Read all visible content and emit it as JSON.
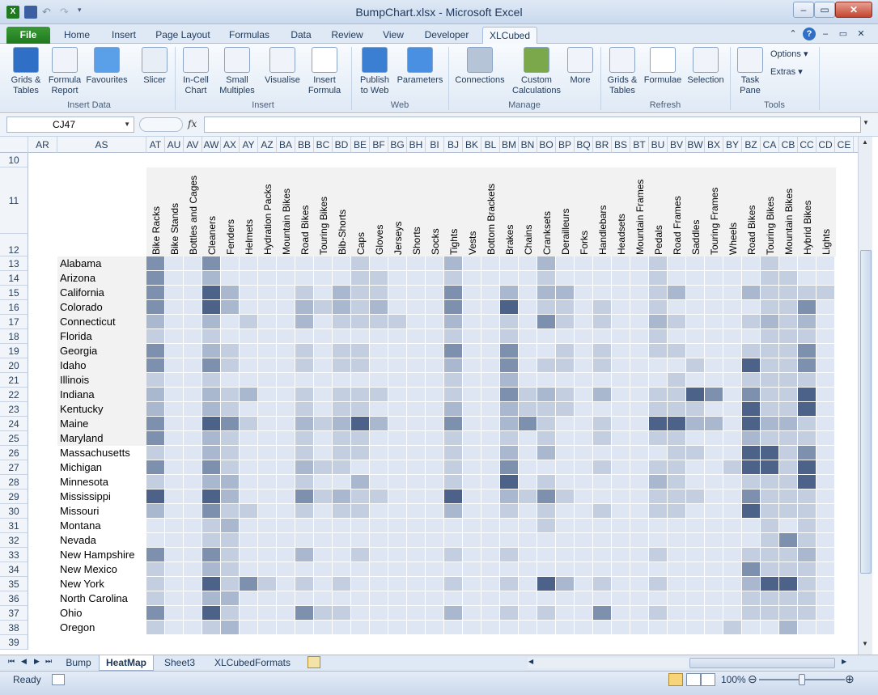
{
  "window": {
    "title": "BumpChart.xlsx  -  Microsoft Excel",
    "minimize": "–",
    "restore": "▭",
    "close": "✕"
  },
  "ribbon_tabs": [
    "File",
    "Home",
    "Insert",
    "Page Layout",
    "Formulas",
    "Data",
    "Review",
    "View",
    "Developer",
    "XLCubed"
  ],
  "active_tab": "XLCubed",
  "ribbon": {
    "buttons": [
      {
        "label": "Grids &\nTables",
        "icon": "cube-icon"
      },
      {
        "label": "Formula\nReport",
        "icon": "formula-report-icon"
      },
      {
        "label": "Favourites",
        "icon": "star-icon"
      },
      {
        "label": "Slicer",
        "icon": "slicer-icon"
      },
      {
        "label": "In-Cell\nChart",
        "icon": "incell-chart-icon"
      },
      {
        "label": "Small\nMultiples",
        "icon": "small-multiples-icon"
      },
      {
        "label": "Visualise",
        "icon": "visualise-icon"
      },
      {
        "label": "Insert\nFormula",
        "icon": "fx-icon"
      },
      {
        "label": "Publish\nto Web",
        "icon": "globe-icon"
      },
      {
        "label": "Parameters",
        "icon": "parameters-icon"
      },
      {
        "label": "Connections",
        "icon": "database-icon"
      },
      {
        "label": "Custom\nCalculations",
        "icon": "calculator-icon"
      },
      {
        "label": "More",
        "icon": "more-icon"
      },
      {
        "label": "Grids &\nTables",
        "icon": "refresh-grid-icon"
      },
      {
        "label": "Formulae",
        "icon": "refresh-fx-icon"
      },
      {
        "label": "Selection",
        "icon": "selection-icon"
      },
      {
        "label": "Task\nPane",
        "icon": "task-pane-icon"
      }
    ],
    "options_label": "Options",
    "extras_label": "Extras",
    "groups": [
      "Insert Data",
      "Insert",
      "Web",
      "Manage",
      "Refresh",
      "Tools"
    ]
  },
  "formula_bar": {
    "name_box": "CJ47",
    "fx": "fx",
    "formula": ""
  },
  "columns": [
    "AR",
    "AS",
    "AT",
    "AU",
    "AV",
    "AW",
    "AX",
    "AY",
    "AZ",
    "BA",
    "BB",
    "BC",
    "BD",
    "BE",
    "BF",
    "BG",
    "BH",
    "BI",
    "BJ",
    "BK",
    "BL",
    "BM",
    "BN",
    "BO",
    "BP",
    "BQ",
    "BR",
    "BS",
    "BT",
    "BU",
    "BV",
    "BW",
    "BX",
    "BY",
    "BZ",
    "CA",
    "CB",
    "CC",
    "CD",
    "CE"
  ],
  "row_numbers": [
    "10",
    "11",
    "12",
    "13",
    "14",
    "15",
    "16",
    "17",
    "18",
    "19",
    "20",
    "21",
    "22",
    "23",
    "24",
    "25",
    "26",
    "27",
    "28",
    "29",
    "30",
    "31",
    "32",
    "33",
    "34",
    "35",
    "36",
    "37",
    "38",
    "39"
  ],
  "products": [
    "Bike Racks",
    "Bike Stands",
    "Bottles and Cages",
    "Cleaners",
    "Fenders",
    "Helmets",
    "Hydration Packs",
    "Mountain Bikes",
    "Road Bikes",
    "Touring Bikes",
    "Bib-Shorts",
    "Caps",
    "Gloves",
    "Jerseys",
    "Shorts",
    "Socks",
    "Tights",
    "Vests",
    "Bottom Brackets",
    "Brakes",
    "Chains",
    "Cranksets",
    "Derailleurs",
    "Forks",
    "Handlebars",
    "Headsets",
    "Mountain Frames",
    "Pedals",
    "Road Frames",
    "Saddles",
    "Touring Frames",
    "Wheels",
    "Road Bikes",
    "Touring Bikes",
    "Mountain Bikes",
    "Hybrid Bikes",
    "Lights"
  ],
  "states": [
    "Alabama",
    "Arizona",
    "California",
    "Colorado",
    "Connecticut",
    "Florida",
    "Georgia",
    "Idaho",
    "Illinois",
    "Indiana",
    "Kentucky",
    "Maine",
    "Maryland",
    "Massachusetts",
    "Michigan",
    "Minnesota",
    "Mississippi",
    "Missouri",
    "Montana",
    "Nevada",
    "New Hampshire",
    "New Mexico",
    "New York",
    "North Carolina",
    "Ohio",
    "Oregon"
  ],
  "heatmap_levels": [
    [
      3,
      0,
      0,
      3,
      0,
      0,
      0,
      0,
      0,
      0,
      0,
      1,
      0,
      0,
      0,
      0,
      2,
      0,
      0,
      0,
      0,
      2,
      0,
      0,
      0,
      0,
      0,
      1,
      0,
      0,
      0,
      0,
      0,
      1,
      0,
      0,
      0
    ],
    [
      3,
      0,
      0,
      2,
      0,
      0,
      0,
      0,
      0,
      0,
      0,
      1,
      1,
      0,
      0,
      0,
      1,
      0,
      0,
      0,
      0,
      1,
      0,
      0,
      0,
      0,
      0,
      1,
      0,
      0,
      0,
      0,
      0,
      1,
      1,
      0,
      0
    ],
    [
      3,
      0,
      0,
      4,
      2,
      0,
      0,
      0,
      1,
      0,
      2,
      1,
      1,
      0,
      0,
      0,
      3,
      0,
      0,
      2,
      0,
      2,
      2,
      0,
      0,
      0,
      0,
      1,
      2,
      0,
      0,
      0,
      2,
      1,
      1,
      1,
      1
    ],
    [
      3,
      0,
      0,
      4,
      2,
      0,
      0,
      0,
      2,
      1,
      2,
      1,
      2,
      0,
      0,
      0,
      3,
      0,
      0,
      4,
      0,
      1,
      1,
      0,
      1,
      0,
      0,
      1,
      0,
      0,
      0,
      0,
      0,
      1,
      1,
      3,
      0
    ],
    [
      2,
      0,
      0,
      2,
      0,
      1,
      0,
      0,
      2,
      0,
      1,
      1,
      1,
      1,
      0,
      0,
      2,
      0,
      0,
      1,
      0,
      3,
      1,
      0,
      1,
      0,
      0,
      2,
      1,
      0,
      0,
      0,
      1,
      2,
      1,
      2,
      0
    ],
    [
      1,
      0,
      0,
      1,
      0,
      0,
      0,
      0,
      0,
      0,
      0,
      0,
      0,
      0,
      0,
      0,
      1,
      0,
      0,
      1,
      0,
      0,
      0,
      0,
      0,
      0,
      0,
      1,
      0,
      0,
      0,
      0,
      0,
      1,
      1,
      1,
      0
    ],
    [
      3,
      0,
      0,
      2,
      1,
      0,
      0,
      0,
      1,
      0,
      1,
      1,
      0,
      0,
      0,
      0,
      3,
      0,
      0,
      3,
      0,
      0,
      1,
      0,
      1,
      0,
      0,
      1,
      1,
      0,
      0,
      0,
      1,
      1,
      1,
      3,
      0
    ],
    [
      3,
      0,
      0,
      3,
      1,
      0,
      0,
      0,
      1,
      0,
      1,
      1,
      0,
      0,
      0,
      0,
      2,
      0,
      0,
      3,
      0,
      1,
      1,
      0,
      1,
      0,
      0,
      0,
      0,
      1,
      0,
      0,
      4,
      1,
      1,
      3,
      0
    ],
    [
      1,
      0,
      0,
      1,
      0,
      0,
      0,
      0,
      0,
      0,
      0,
      0,
      0,
      0,
      0,
      0,
      1,
      0,
      0,
      2,
      0,
      0,
      0,
      0,
      0,
      0,
      0,
      0,
      1,
      0,
      0,
      0,
      1,
      1,
      1,
      1,
      0
    ],
    [
      2,
      0,
      0,
      2,
      1,
      2,
      0,
      0,
      1,
      0,
      1,
      1,
      1,
      0,
      0,
      0,
      1,
      0,
      0,
      3,
      1,
      2,
      1,
      0,
      2,
      0,
      0,
      1,
      1,
      4,
      3,
      0,
      3,
      1,
      1,
      4,
      0
    ],
    [
      2,
      0,
      0,
      2,
      1,
      0,
      0,
      0,
      1,
      0,
      1,
      1,
      0,
      0,
      0,
      0,
      2,
      0,
      0,
      2,
      1,
      1,
      1,
      0,
      0,
      0,
      0,
      1,
      1,
      1,
      0,
      0,
      4,
      1,
      1,
      4,
      0
    ],
    [
      3,
      0,
      0,
      4,
      3,
      1,
      0,
      0,
      2,
      1,
      2,
      4,
      2,
      0,
      0,
      0,
      3,
      0,
      0,
      2,
      3,
      1,
      0,
      0,
      1,
      0,
      0,
      4,
      4,
      2,
      2,
      0,
      4,
      2,
      2,
      1,
      0
    ],
    [
      3,
      0,
      0,
      2,
      1,
      0,
      0,
      0,
      1,
      0,
      1,
      1,
      0,
      0,
      0,
      0,
      1,
      0,
      0,
      1,
      0,
      1,
      0,
      0,
      1,
      0,
      0,
      1,
      1,
      0,
      0,
      0,
      2,
      1,
      1,
      1,
      0
    ],
    [
      1,
      0,
      0,
      2,
      1,
      0,
      0,
      0,
      1,
      0,
      1,
      1,
      0,
      0,
      0,
      0,
      1,
      0,
      0,
      2,
      0,
      2,
      0,
      0,
      0,
      0,
      0,
      0,
      1,
      1,
      0,
      0,
      4,
      4,
      1,
      3,
      0
    ],
    [
      3,
      0,
      0,
      3,
      1,
      0,
      0,
      0,
      2,
      1,
      1,
      0,
      0,
      0,
      0,
      0,
      1,
      0,
      0,
      3,
      0,
      0,
      0,
      0,
      1,
      0,
      0,
      1,
      1,
      0,
      0,
      1,
      4,
      4,
      1,
      4,
      0
    ],
    [
      1,
      0,
      0,
      2,
      2,
      0,
      0,
      0,
      1,
      0,
      0,
      2,
      0,
      0,
      0,
      0,
      1,
      0,
      0,
      4,
      0,
      1,
      0,
      0,
      0,
      0,
      0,
      2,
      1,
      0,
      0,
      0,
      1,
      1,
      1,
      4,
      0
    ],
    [
      4,
      0,
      0,
      4,
      2,
      0,
      0,
      0,
      3,
      1,
      2,
      1,
      1,
      0,
      0,
      0,
      4,
      0,
      0,
      2,
      1,
      3,
      1,
      0,
      0,
      0,
      0,
      1,
      1,
      1,
      0,
      0,
      3,
      1,
      1,
      1,
      0
    ],
    [
      2,
      0,
      0,
      3,
      1,
      1,
      0,
      0,
      1,
      0,
      1,
      1,
      0,
      0,
      0,
      0,
      2,
      0,
      0,
      1,
      0,
      1,
      0,
      0,
      1,
      0,
      0,
      1,
      1,
      0,
      0,
      0,
      4,
      1,
      1,
      1,
      0
    ],
    [
      0,
      0,
      0,
      1,
      2,
      0,
      0,
      0,
      0,
      0,
      0,
      0,
      0,
      0,
      0,
      0,
      0,
      0,
      0,
      0,
      0,
      1,
      0,
      0,
      0,
      0,
      0,
      0,
      0,
      0,
      0,
      0,
      0,
      1,
      0,
      1,
      0
    ],
    [
      0,
      0,
      0,
      1,
      1,
      0,
      0,
      0,
      0,
      0,
      0,
      0,
      0,
      0,
      0,
      0,
      0,
      0,
      0,
      0,
      0,
      0,
      0,
      0,
      0,
      0,
      0,
      0,
      0,
      0,
      0,
      0,
      0,
      1,
      3,
      1,
      0
    ],
    [
      3,
      0,
      0,
      3,
      1,
      0,
      0,
      0,
      2,
      0,
      0,
      1,
      0,
      0,
      0,
      0,
      1,
      0,
      0,
      1,
      0,
      0,
      0,
      0,
      0,
      0,
      0,
      1,
      0,
      0,
      0,
      0,
      1,
      1,
      1,
      2,
      0
    ],
    [
      1,
      0,
      0,
      2,
      1,
      0,
      0,
      0,
      0,
      0,
      0,
      0,
      0,
      0,
      0,
      0,
      0,
      0,
      0,
      0,
      0,
      0,
      0,
      0,
      0,
      0,
      0,
      0,
      0,
      0,
      0,
      0,
      3,
      1,
      1,
      1,
      0
    ],
    [
      1,
      0,
      0,
      4,
      1,
      3,
      1,
      0,
      1,
      0,
      1,
      0,
      0,
      0,
      0,
      0,
      1,
      0,
      0,
      1,
      0,
      4,
      2,
      0,
      1,
      0,
      0,
      1,
      0,
      0,
      0,
      0,
      2,
      4,
      4,
      1,
      0
    ],
    [
      1,
      0,
      0,
      2,
      2,
      0,
      0,
      0,
      0,
      0,
      0,
      0,
      0,
      0,
      0,
      0,
      0,
      0,
      0,
      0,
      0,
      0,
      0,
      0,
      0,
      0,
      0,
      0,
      0,
      0,
      0,
      0,
      1,
      1,
      1,
      1,
      0
    ],
    [
      3,
      0,
      0,
      4,
      1,
      0,
      0,
      0,
      3,
      1,
      1,
      0,
      0,
      0,
      0,
      0,
      2,
      0,
      0,
      1,
      0,
      1,
      0,
      0,
      3,
      0,
      0,
      1,
      0,
      0,
      0,
      0,
      1,
      1,
      1,
      1,
      0
    ],
    [
      1,
      0,
      0,
      1,
      2,
      0,
      0,
      0,
      0,
      0,
      0,
      0,
      0,
      0,
      0,
      0,
      0,
      0,
      0,
      0,
      0,
      0,
      0,
      0,
      0,
      0,
      0,
      0,
      0,
      0,
      0,
      1,
      0,
      0,
      2,
      0,
      0
    ]
  ],
  "heat_colors": [
    "#dde6f2",
    "#c3cfe0",
    "#a9b8ce",
    "#7d90ad",
    "#4c6288"
  ],
  "sheet_tabs": [
    "Bump",
    "HeatMap",
    "Sheet3",
    "XLCubedFormats"
  ],
  "active_sheet": "HeatMap",
  "status": {
    "ready": "Ready",
    "zoom": "100%"
  }
}
